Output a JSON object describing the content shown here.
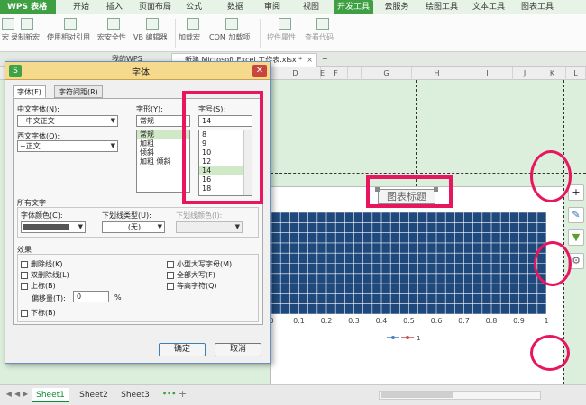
{
  "menubar": {
    "app_label": "WPS 表格",
    "items": [
      "开始",
      "插入",
      "页面布局",
      "公式",
      "数据",
      "审阅",
      "视图",
      "开发工具",
      "云服务",
      "绘图工具",
      "文本工具",
      "图表工具"
    ],
    "active": "开发工具"
  },
  "ribbon": {
    "buttons": [
      "宏",
      "录制新宏",
      "使用相对引用",
      "宏安全性",
      "VB 编辑器",
      "加载宏",
      "COM 加载项",
      "控件属性",
      "查看代码"
    ]
  },
  "doc_tabs": [
    {
      "label": "我的WPS"
    },
    {
      "label": "新建 Microsoft Excel 工作表.xlsx *"
    }
  ],
  "sheet": {
    "columns": [
      "D",
      "E",
      "F",
      "G",
      "H",
      "I",
      "J",
      "K",
      "L"
    ],
    "tabs": [
      "Sheet1",
      "Sheet2",
      "Sheet3"
    ]
  },
  "chart_data": {
    "type": "bar",
    "title": "图表标题",
    "x_ticks": [
      "0",
      "0.1",
      "0.2",
      "0.3",
      "0.4",
      "0.5",
      "0.6",
      "0.7",
      "0.8",
      "0.9",
      "1"
    ],
    "xlim": [
      0,
      1
    ],
    "legend_placement": "bottom",
    "legend_marker": "1",
    "colors": {
      "bar": "#1f497d",
      "grid": "#ffffff",
      "legend_line": "#4f81bd",
      "legend_line2": "#c0504d"
    }
  },
  "dialog": {
    "title": "字体",
    "tabs": [
      "字体(F)",
      "字符间距(R)"
    ],
    "chinese_font_label": "中文字体(N):",
    "chinese_font_value": "+中文正文",
    "western_font_label": "西文字体(O):",
    "western_font_value": "+正文",
    "style_label": "字形(Y):",
    "style_value": "常规",
    "style_list": [
      "常规",
      "加粗",
      "倾斜",
      "加粗 倾斜"
    ],
    "size_label": "字号(S):",
    "size_value": "14",
    "size_list": [
      "8",
      "9",
      "10",
      "12",
      "14",
      "16",
      "18"
    ],
    "all_text_label": "所有文字",
    "font_color_label": "字体颜色(C):",
    "underline_type_label": "下划线类型(U):",
    "underline_type_value": "(无)",
    "underline_color_label": "下划线颜色(I):",
    "effects_label": "效果",
    "effects_left": [
      "删除线(K)",
      "双删除线(L)",
      "上标(B)"
    ],
    "offset_label": "偏移量(T):",
    "offset_value": "0",
    "offset_unit": "%",
    "subscript_label": "下标(B)",
    "effects_right": [
      "小型大写字母(M)",
      "全部大写(F)",
      "等高字符(Q)"
    ],
    "ok_label": "确定",
    "cancel_label": "取消"
  },
  "colors": {
    "accent": "#3f9f43",
    "callout": "#e8155f",
    "sheet_bg": "#dcefdc",
    "font_color_swatch": "#555555"
  }
}
